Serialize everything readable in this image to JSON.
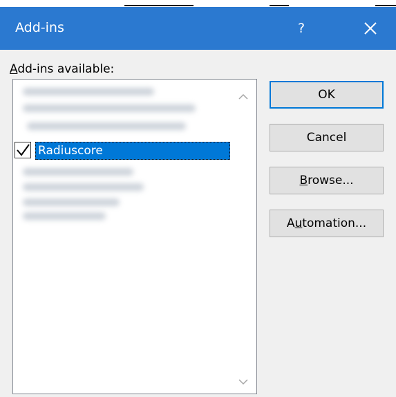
{
  "dialog": {
    "title": "Add-ins",
    "help_label": "?",
    "list_label_mnemonic": "A",
    "list_label_rest": "dd-ins available:"
  },
  "addins": {
    "selected_item": {
      "label": "Radiuscore",
      "checked": true
    }
  },
  "buttons": {
    "ok": "OK",
    "cancel": "Cancel",
    "browse_mnemonic": "B",
    "browse_rest": "rowse...",
    "automation_pre": "A",
    "automation_mnemonic": "u",
    "automation_rest": "tomation..."
  },
  "colors": {
    "titlebar": "#2b79d0",
    "selection": "#0078d7",
    "default_button_border": "#0078d7"
  }
}
